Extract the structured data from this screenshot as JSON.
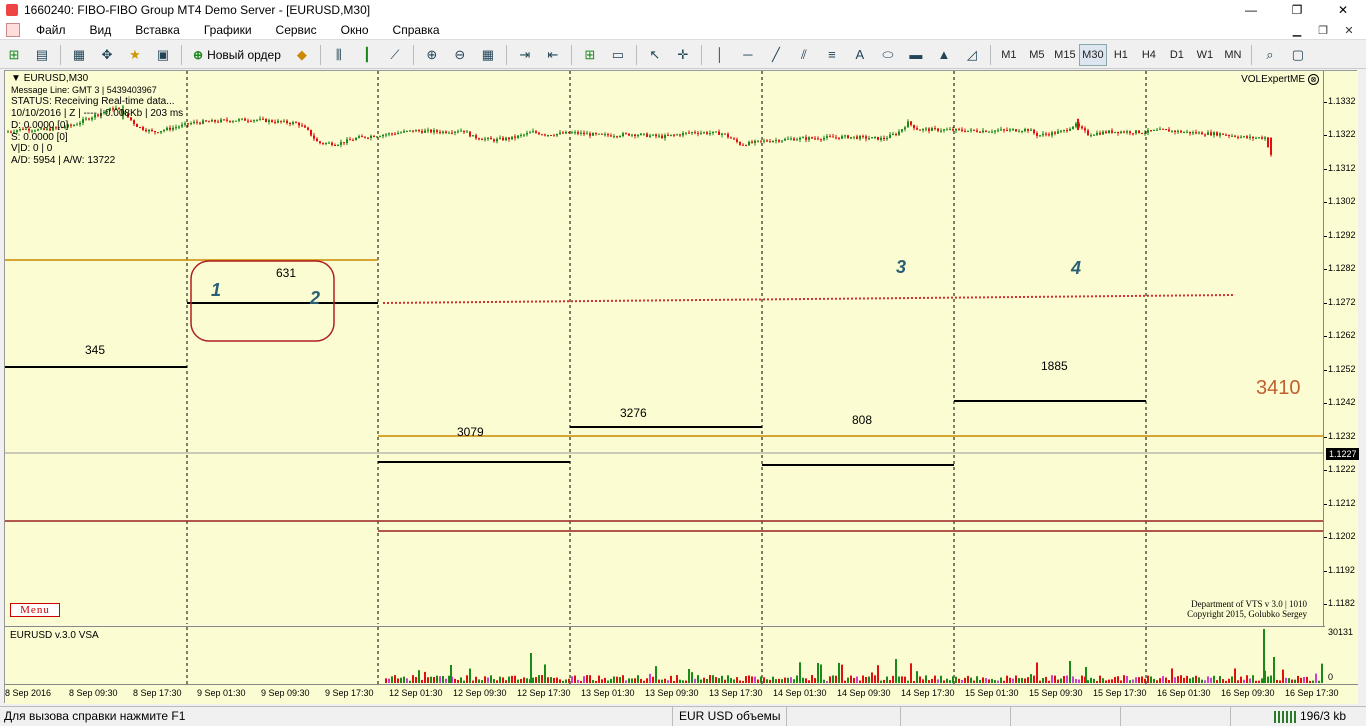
{
  "window": {
    "title": "1660240: FIBO-FIBO Group MT4 Demo Server - [EURUSD,M30]",
    "minimize": "—",
    "maximize": "❐",
    "close": "✕"
  },
  "menu": {
    "items": [
      "Файл",
      "Вид",
      "Вставка",
      "Графики",
      "Сервис",
      "Окно",
      "Справка"
    ]
  },
  "toolbar": {
    "new_order": "Новый ордер",
    "timeframes": [
      "M1",
      "M5",
      "M15",
      "M30",
      "H1",
      "H4",
      "D1",
      "W1",
      "MN"
    ],
    "active_timeframe": "M30"
  },
  "chart": {
    "symbol_label": "EURUSD,M30",
    "info_lines": [
      "Message Line: GMT 3 | 5439403967",
      "STATUS:  Receiving Real-time data...",
      "10/10/2016 | Z | ---- | 0.008Kb | 203 ms",
      "D: 0.0000  [0]",
      "S: 0.0000  [0]",
      "V|D: 0 | 0",
      "A/D: 5954 | A/W: 13722"
    ],
    "vol_expert": "VOLExpertME",
    "menu_button": "Menu",
    "copyright_1": "Department of VTS v 3.0 | 1010",
    "copyright_2": "Copyright 2015, Golubko Sergey",
    "price_ticks": [
      "1.1332",
      "1.1322",
      "1.1312",
      "1.1302",
      "1.1292",
      "1.1282",
      "1.1272",
      "1.1262",
      "1.1252",
      "1.1242",
      "1.1232",
      "1.1222",
      "1.1212",
      "1.1202",
      "1.1192",
      "1.1182"
    ],
    "current_price": "1.1227",
    "annotations": [
      {
        "text": "345"
      },
      {
        "text": "631"
      },
      {
        "text": "3079"
      },
      {
        "text": "3276"
      },
      {
        "text": "808"
      },
      {
        "text": "1885"
      },
      {
        "text": "3410"
      },
      {
        "text": "1"
      },
      {
        "text": "2"
      },
      {
        "text": "3"
      },
      {
        "text": "4"
      }
    ],
    "sub_label": "EURUSD v.3.0 VSA",
    "sub_max": "30131",
    "sub_min": "0",
    "time_ticks": [
      "8 Sep 2016",
      "8 Sep 09:30",
      "8 Sep 17:30",
      "9 Sep 01:30",
      "9 Sep 09:30",
      "9 Sep 17:30",
      "12 Sep 01:30",
      "12 Sep 09:30",
      "12 Sep 17:30",
      "13 Sep 01:30",
      "13 Sep 09:30",
      "13 Sep 17:30",
      "14 Sep 01:30",
      "14 Sep 09:30",
      "14 Sep 17:30",
      "15 Sep 01:30",
      "15 Sep 09:30",
      "15 Sep 17:30",
      "16 Sep 01:30",
      "16 Sep 09:30",
      "16 Sep 17:30"
    ]
  },
  "status": {
    "help": "Для вызова справки нажмите F1",
    "profile": "EUR USD объемы",
    "connection": "196/3 kb"
  },
  "colors": {
    "chart_bg": "#fcfcd2",
    "bull": "#1a8a1a",
    "bear": "#e01010",
    "level_orange": "#c88a00",
    "level_dark_red": "#9a2020",
    "annotation_blue": "#2a5f75"
  }
}
